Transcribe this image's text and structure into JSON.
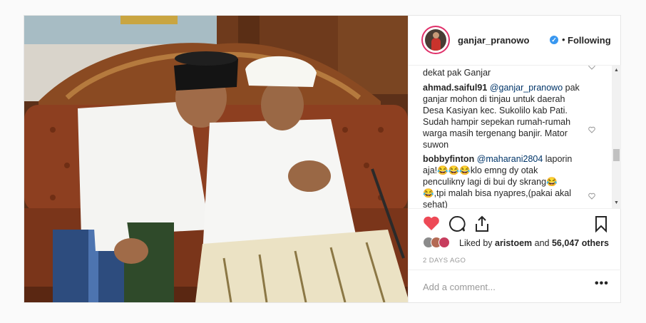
{
  "header": {
    "username": "ganjar_pranowo",
    "verified_icon": "check-badge-icon",
    "separator": "•",
    "follow_status": "Following"
  },
  "comments": [
    {
      "text": "dekat pak Ganjar"
    },
    {
      "author": "ahmad.saiful91",
      "mention": "@ganjar_pranowo",
      "lines": [
        "pak",
        "ganjar mohon di tinjau untuk daerah",
        "Desa Kasiyan kec. Sukolilo kab Pati.",
        "Sudah hampir sepekan rumah-rumah",
        "warga masih tergenang banjir. Mator",
        "suwon"
      ]
    },
    {
      "author": "bobbyfinton",
      "mention": "@maharani2804",
      "lines": [
        "laporin",
        "aja!😂😂😂klo emng dy otak",
        "penculikny lagi di bui dy skrang😂",
        "😂,tpi malah bisa nyapres,(pakai akal",
        "sehat)"
      ]
    }
  ],
  "actions": {
    "like_icon": "heart-icon",
    "comment_icon": "comment-icon",
    "share_icon": "share-icon",
    "save_icon": "bookmark-icon",
    "like_color": "#ed4956"
  },
  "likes": {
    "prefix": "Liked by",
    "user": "aristoem",
    "joiner": "and",
    "count": "56,047 others"
  },
  "timestamp": "2 DAYS AGO",
  "add_comment": {
    "placeholder": "Add a comment...",
    "more_label": "•••"
  }
}
